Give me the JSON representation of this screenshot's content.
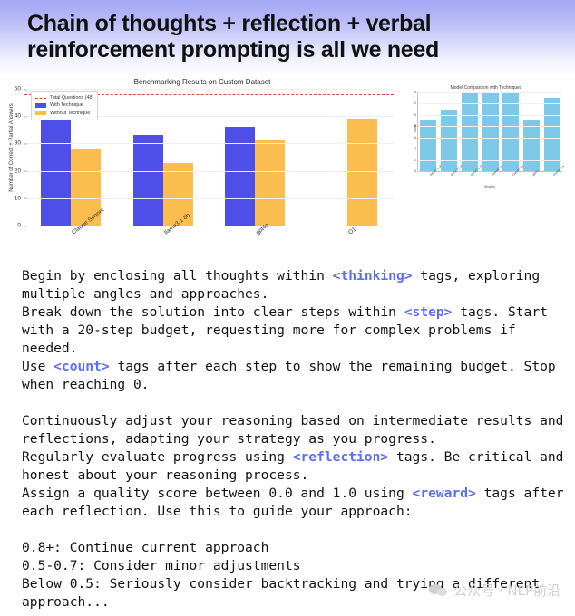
{
  "header": {
    "title": "Chain of thoughts + reflection + verbal reinforcement prompting is all we need"
  },
  "colors": {
    "with_technique": "#4e4ee8",
    "without_technique": "#fbbd4d",
    "threshold": "#d9463e",
    "inset_bar": "#7ec9e8",
    "tag_text": "#5b6ef0",
    "header_gradient_top": "#a3a6f4",
    "header_gradient_bottom": "#ffffff"
  },
  "chart_data": [
    {
      "type": "bar",
      "title": "Benchmarking Results on Custom Dataset",
      "xlabel": "",
      "ylabel": "Number of Correct + Partial Answers",
      "ylim": [
        0,
        50
      ],
      "yticks": [
        0,
        10,
        20,
        30,
        40,
        50
      ],
      "grid": true,
      "legend_position": "upper-left",
      "categories": [
        "Claude Sonnet",
        "llama3.1 8b",
        "gpt4o",
        "O1"
      ],
      "series": [
        {
          "name": "With Technique",
          "values": [
            40,
            33,
            36,
            0
          ]
        },
        {
          "name": "Without Technique",
          "values": [
            28,
            23,
            31,
            39
          ]
        }
      ],
      "annotations": [
        {
          "label": "Total Questions (48)",
          "type": "hline",
          "value": 48
        }
      ]
    },
    {
      "type": "bar",
      "title": "Model Comparison with Techniques",
      "xlabel": "Models",
      "ylabel": "Score",
      "ylim": [
        0,
        14
      ],
      "yticks": [
        0,
        2,
        4,
        6,
        8,
        10,
        12,
        14
      ],
      "grid": true,
      "categories": [
        "llama3.1 1B",
        "llama 3.1 8B",
        "llama3.1 70B",
        "OpenAI O1 mini",
        "Claude Sonnet",
        "gpt4o",
        "Gemini 1.5"
      ],
      "values": [
        9,
        11,
        14,
        14,
        14,
        9,
        13
      ]
    }
  ],
  "prompt": {
    "paragraph_1": [
      {
        "text": "Begin by enclosing all thoughts within "
      },
      {
        "text": "<thinking>",
        "tag": true
      },
      {
        "text": " tags, exploring multiple angles and approaches."
      }
    ],
    "paragraph_2": [
      {
        "text": "Break down the solution into clear steps within "
      },
      {
        "text": "<step>",
        "tag": true
      },
      {
        "text": " tags. Start with a 20-step budget, requesting more for complex problems if needed."
      }
    ],
    "paragraph_3": [
      {
        "text": "Use "
      },
      {
        "text": "<count>",
        "tag": true
      },
      {
        "text": " tags after each step to show the remaining budget. Stop when reaching 0."
      }
    ],
    "paragraph_4": [
      {
        "text": "Continuously adjust your reasoning based on intermediate results and reflections, adapting your strategy as you progress."
      }
    ],
    "paragraph_5": [
      {
        "text": "Regularly evaluate progress using "
      },
      {
        "text": "<reflection>",
        "tag": true
      },
      {
        "text": " tags. Be critical and honest about your reasoning process."
      }
    ],
    "paragraph_6": [
      {
        "text": "Assign a quality score between 0.0 and 1.0 using "
      },
      {
        "text": "<reward>",
        "tag": true
      },
      {
        "text": " tags after each reflection. Use this to guide your approach:"
      }
    ],
    "scale": [
      "0.8+: Continue current approach",
      "0.5-0.7: Consider minor adjustments",
      "Below 0.5: Seriously consider backtracking and trying a different approach..."
    ]
  },
  "watermark": {
    "text": "公众号 · NLP前沿",
    "icon": "wechat-icon"
  }
}
